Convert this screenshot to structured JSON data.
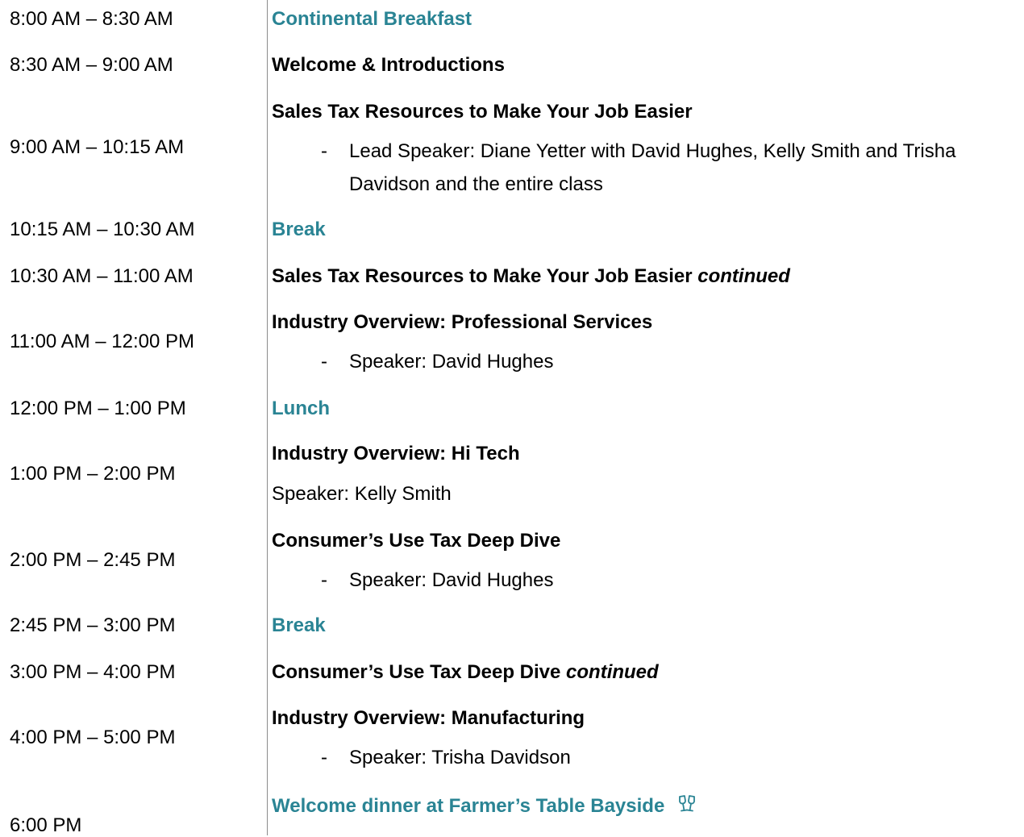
{
  "colors": {
    "accent": "#2a8494",
    "text": "#000000",
    "divider": "#8c8c8c"
  },
  "schedule": {
    "r1": {
      "time": "8:00 AM – 8:30 AM",
      "title": "Continental Breakfast"
    },
    "r2": {
      "time": "8:30 AM – 9:00 AM",
      "title": "Welcome & Introductions"
    },
    "r3": {
      "time": "9:00 AM – 10:15 AM",
      "title": "Sales Tax Resources to Make Your Job Easier",
      "bullet": "-",
      "detail_1": "Lead Speaker: Diane Yetter with David Hughes, Kelly Smith and Trisha",
      "detail_2": "Davidson and the entire class"
    },
    "r4": {
      "time": "10:15 AM – 10:30 AM",
      "title": "Break"
    },
    "r5": {
      "time": "10:30 AM – 11:00 AM",
      "title": "Sales Tax Resources to Make Your Job Easier",
      "note": "continued"
    },
    "r6": {
      "time": "11:00 AM – 12:00 PM",
      "title": "Industry Overview: Professional Services",
      "bullet": "-",
      "detail": "Speaker: David Hughes"
    },
    "r7": {
      "time": "12:00 PM – 1:00 PM",
      "title": "Lunch"
    },
    "r8": {
      "time": "1:00 PM – 2:00 PM",
      "title": "Industry Overview: Hi Tech",
      "detail": "Speaker: Kelly Smith"
    },
    "r9": {
      "time": "2:00 PM – 2:45 PM",
      "title": "Consumer’s Use Tax Deep Dive",
      "bullet": "-",
      "detail": "Speaker: David Hughes"
    },
    "r10": {
      "time": "2:45 PM – 3:00 PM",
      "title": "Break"
    },
    "r11": {
      "time": "3:00 PM – 4:00 PM",
      "title": "Consumer’s Use Tax Deep Dive",
      "note": "continued"
    },
    "r12": {
      "time": "4:00 PM – 5:00 PM",
      "title": "Industry Overview: Manufacturing",
      "bullet": "-",
      "detail": "Speaker: Trisha Davidson"
    },
    "r13": {
      "time": "6:00 PM",
      "title": "Welcome dinner at Farmer’s Table Bayside",
      "icon": "toast-glasses-icon"
    }
  }
}
